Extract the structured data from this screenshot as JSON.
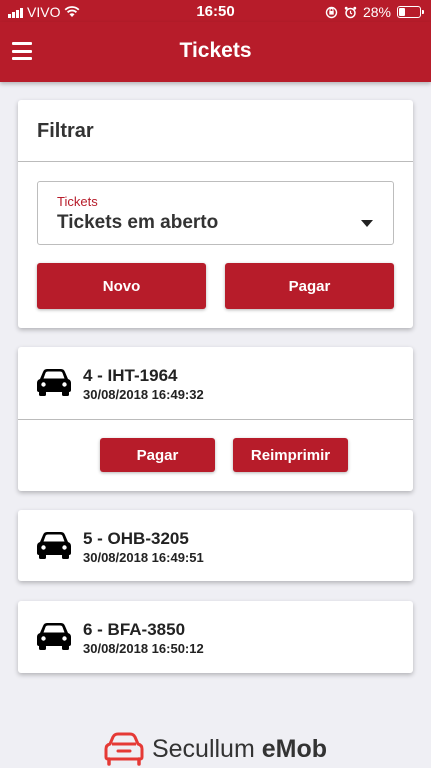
{
  "status_bar": {
    "carrier": "VIVO",
    "time": "16:50",
    "battery": "28%",
    "battery_level": 0.28
  },
  "nav": {
    "title": "Tickets",
    "menu_icon": "hamburger-menu-icon"
  },
  "filter": {
    "title": "Filtrar",
    "select_label": "Tickets",
    "select_value": "Tickets em aberto",
    "new_button": "Novo",
    "pay_button": "Pagar"
  },
  "tickets": [
    {
      "title": "4 - IHT-1964",
      "datetime": "30/08/2018 16:49:32",
      "pay_button": "Pagar",
      "reprint_button": "Reimprimir"
    },
    {
      "title": "5 - OHB-3205",
      "datetime": "30/08/2018 16:49:51"
    },
    {
      "title": "6 - BFA-3850",
      "datetime": "30/08/2018 16:50:12"
    }
  ],
  "footer": {
    "brand_prefix": "Secullum",
    "brand_suffix": "eMob"
  },
  "colors": {
    "primary": "#b71c2a",
    "background": "#efeff4",
    "card": "#ffffff",
    "text": "#222222"
  }
}
